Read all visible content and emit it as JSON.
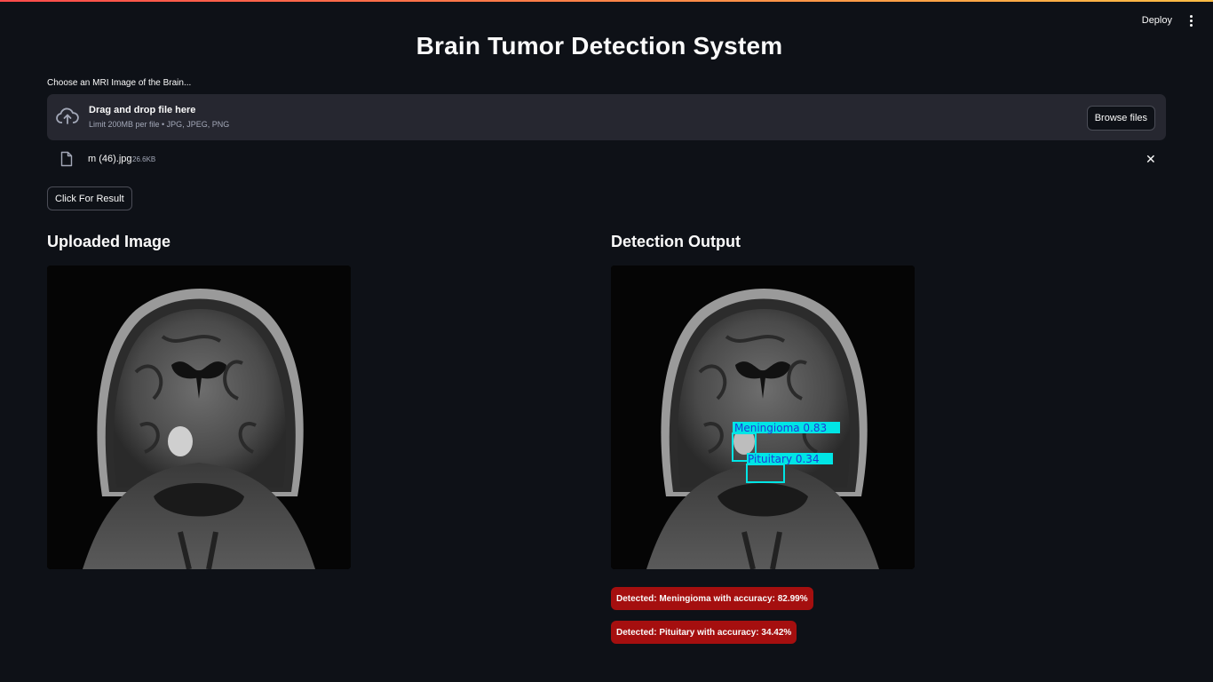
{
  "header": {
    "deploy_label": "Deploy",
    "menu_icon": "vertical-dots-icon"
  },
  "page": {
    "title": "Brain Tumor Detection System"
  },
  "uploader": {
    "label": "Choose an MRI Image of the Brain...",
    "drop_title": "Drag and drop file here",
    "drop_subtitle": "Limit 200MB per file • JPG, JPEG, PNG",
    "browse_label": "Browse files",
    "cloud_icon": "cloud-upload-icon"
  },
  "uploaded_file": {
    "name": "m (46).jpg",
    "size": "26.6KB",
    "file_icon": "file-icon",
    "close_symbol": "✕"
  },
  "actions": {
    "result_button": "Click For Result"
  },
  "columns": {
    "left_heading": "Uploaded Image",
    "right_heading": "Detection Output"
  },
  "detections": {
    "box1_label": "Meningioma  0.83",
    "box2_label": "Pituitary  0.34",
    "box_color": "#00e5e5"
  },
  "alerts": [
    {
      "text": "Detected: Meningioma with accuracy: 82.99%"
    },
    {
      "text": "Detected: Pituitary with accuracy: 34.42%"
    }
  ],
  "colors": {
    "background": "#0e1117",
    "surface": "#262730",
    "alert_red": "#a50f0f"
  }
}
